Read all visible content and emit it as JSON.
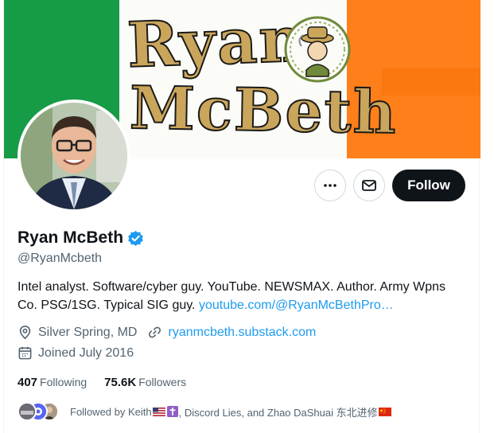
{
  "banner": {
    "logo_line1": "Ryan",
    "logo_line2": "McBeth",
    "colors": {
      "green": "#169b46",
      "white": "#fbfbf8",
      "orange": "#ff7f1a"
    }
  },
  "actions": {
    "more_icon": "more-horizontal-icon",
    "message_icon": "envelope-icon",
    "follow_label": "Follow"
  },
  "profile": {
    "display_name": "Ryan McBeth",
    "verified_icon": "verified-badge-icon",
    "handle": "@RyanMcbeth",
    "bio_text": "Intel analyst. Software/cyber guy. YouTube. NEWSMAX. Author. Army Wpns Co. PSG/1SG. Typical SIG guy.",
    "bio_link": "youtube.com/@RyanMcBethPro…",
    "location": "Silver Spring, MD",
    "website": "ryanmcbeth.substack.com",
    "joined": "Joined July 2016"
  },
  "stats": {
    "following_count": "407",
    "following_label": "Following",
    "followers_count": "75.6K",
    "followers_label": "Followers"
  },
  "followed_by": {
    "prefix": "Followed by Keith",
    "middle": ", Discord Lies, and Zhao DaShuai 东北进修"
  },
  "colors": {
    "link": "#1d9bf0",
    "text": "#0f1419",
    "muted": "#536471"
  }
}
